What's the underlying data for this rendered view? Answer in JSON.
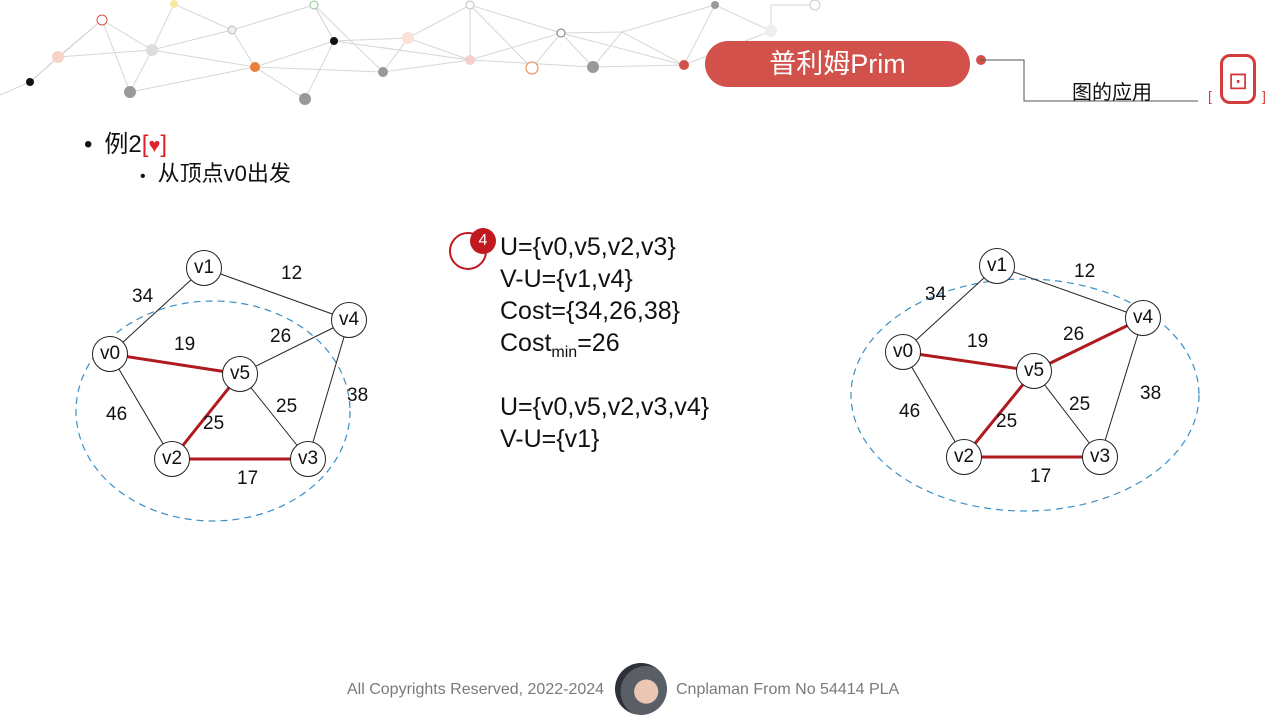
{
  "header": {
    "title": "普利姆Prim",
    "section": "图的应用",
    "accent_color": "#d2524b",
    "seal_icon": "red-seal-stamp"
  },
  "content": {
    "bullet1_prefix": "例2",
    "bullet1_bracket_open": "[",
    "bullet1_bracket_close": "]",
    "bullet1_icon": "heart-icon",
    "bullet2": "从顶点v0出发"
  },
  "left_graph": {
    "nodes": {
      "v0": "v0",
      "v1": "v1",
      "v2": "v2",
      "v3": "v3",
      "v4": "v4",
      "v5": "v5"
    },
    "weights": {
      "v0_v1": "34",
      "v1_v4": "12",
      "v0_v5": "19",
      "v5_v4": "26",
      "v0_v2": "46",
      "v2_v5": "25",
      "v5_v3": "25",
      "v4_v3": "38",
      "v2_v3": "17"
    },
    "tree_edges": [
      "v0-v5",
      "v5-v2",
      "v2-v3"
    ]
  },
  "right_graph": {
    "nodes": {
      "v0": "v0",
      "v1": "v1",
      "v2": "v2",
      "v3": "v3",
      "v4": "v4",
      "v5": "v5"
    },
    "weights": {
      "v0_v1": "34",
      "v1_v4": "12",
      "v0_v5": "19",
      "v5_v4": "26",
      "v0_v2": "46",
      "v2_v5": "25",
      "v5_v3": "25",
      "v4_v3": "38",
      "v2_v3": "17"
    },
    "tree_edges": [
      "v0-v5",
      "v5-v2",
      "v2-v3",
      "v5-v4"
    ]
  },
  "step": {
    "number": "4",
    "line1": "U={v0,v5,v2,v3}",
    "line2": "V-U={v1,v4}",
    "line3": "Cost={34,26,38}",
    "line4_prefix": "Cost",
    "line4_sub": "min",
    "line4_suffix": "=26",
    "line5": "U={v0,v5,v2,v3,v4}",
    "line6": "V-U={v1}"
  },
  "footer": {
    "left": "All Copyrights Reserved, 2022-2024",
    "right": "Cnplaman From No 54414 PLA"
  },
  "colors": {
    "tree_edge": "#b0191e",
    "region": "#3b8fc4"
  }
}
